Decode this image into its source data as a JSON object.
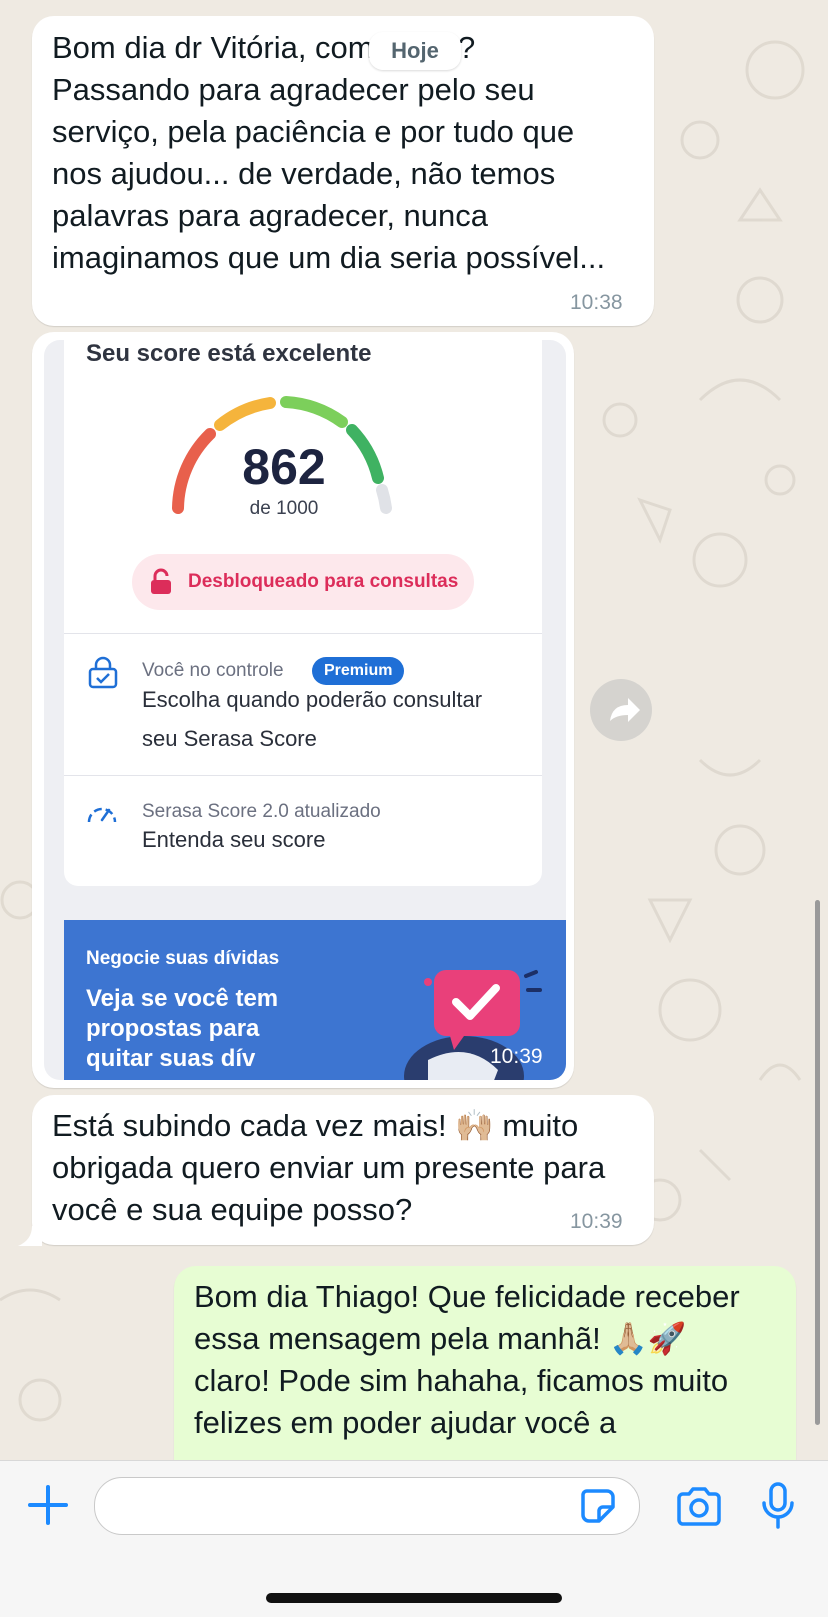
{
  "date_chip": "Hoje",
  "messages": [
    {
      "text": "Bom dia dr Vitória, como está?\nPassando para agradecer pelo seu\nserviço, pela paciência e por tudo que\nnos ajudou... de verdade, não temos\npalavras para agradecer, nunca\nimaginamos que um dia seria possível...",
      "time": "10:38"
    },
    {
      "text": "Está subindo cada vez mais! 🙌🏼 muito\nobrigada quero enviar um presente para\nvocê e sua equipe posso?",
      "time": "10:39"
    },
    {
      "text": "Bom dia Thiago! Que felicidade receber\nessa mensagem pela manhã! 🙏🏼🚀\nclaro! Pode sim hahaha, ficamos muito\nfelizes em poder ajudar você a"
    }
  ],
  "image_message": {
    "time": "10:39",
    "score_title": "Seu score está excelente",
    "score_value": "862",
    "score_scale": "de 1000",
    "unlock_label": "Desbloqueado para consultas",
    "control_label": "Você no controle",
    "premium_badge": "Premium",
    "control_text": "Escolha quando poderão consultar\nseu Serasa Score",
    "update_label": "Serasa Score 2.0 atualizado",
    "update_text": "Entenda seu score",
    "banner_title": "Negocie suas dívidas",
    "banner_text": "Veja se você tem\npropostas para\nquitar suas dív"
  },
  "icons": {
    "forward": "forward-icon",
    "plus": "plus-icon",
    "sticker": "sticker-icon",
    "camera": "camera-icon",
    "mic": "microphone-icon",
    "lock": "lock-icon",
    "lock_check": "lock-check-icon",
    "speedometer": "speedometer-icon"
  },
  "colors": {
    "accent": "#1c8aff",
    "outgoing_bubble": "#e7fdd3",
    "incoming_bubble": "#ffffff",
    "unlock_red": "#dc2d5a",
    "banner_blue": "#3d75d1"
  }
}
